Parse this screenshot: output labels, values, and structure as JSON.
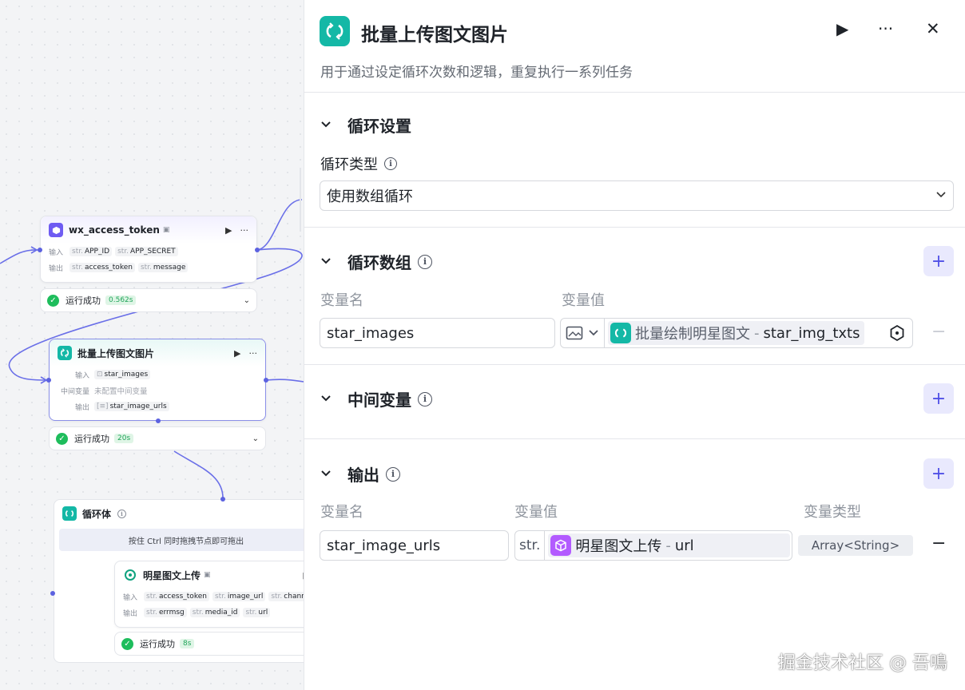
{
  "canvas": {
    "wx_node": {
      "title": "wx_access_token",
      "input_label": "输入",
      "output_label": "输出",
      "inputs": [
        {
          "type": "str.",
          "name": "APP_ID"
        },
        {
          "type": "str.",
          "name": "APP_SECRET"
        }
      ],
      "outputs": [
        {
          "type": "str.",
          "name": "access_token"
        },
        {
          "type": "str.",
          "name": "message"
        }
      ],
      "status": "运行成功",
      "time": "0.562s"
    },
    "loop_node": {
      "title": "批量上传图文图片",
      "input_label": "输入",
      "mid_label": "中间变量",
      "output_label": "输出",
      "input_value": "star_images",
      "mid_value": "未配置中间变量",
      "output_value": "star_image_urls",
      "status": "运行成功",
      "time": "20s"
    },
    "loop_body": {
      "title": "循环体",
      "hint": "按住 Ctrl 同时拖拽节点即可拖出"
    },
    "upload_node": {
      "title": "明星图文上传",
      "input_label": "输入",
      "output_label": "输出",
      "inputs": [
        {
          "type": "str.",
          "name": "access_token"
        },
        {
          "type": "str.",
          "name": "image_url"
        },
        {
          "type": "str.",
          "name": "channel"
        }
      ],
      "outputs": [
        {
          "type": "str.",
          "name": "errmsg"
        },
        {
          "type": "str.",
          "name": "media_id"
        },
        {
          "type": "str.",
          "name": "url"
        }
      ],
      "status": "运行成功",
      "time": "8s"
    }
  },
  "panel": {
    "title": "批量上传图文图片",
    "description": "用于通过设定循环次数和逻辑，重复执行一系列任务",
    "loop_settings": {
      "title": "循环设置",
      "type_label": "循环类型",
      "type_value": "使用数组循环"
    },
    "loop_array": {
      "title": "循环数组",
      "col_name": "变量名",
      "col_value": "变量值",
      "var_name": "star_images",
      "ref_node": "批量绘制明星图文",
      "ref_sep": "-",
      "ref_var": "star_img_txts"
    },
    "intermediate": {
      "title": "中间变量"
    },
    "output": {
      "title": "输出",
      "col_name": "变量名",
      "col_value": "变量值",
      "col_type": "变量类型",
      "var_name": "star_image_urls",
      "ref_type": "str.",
      "ref_node": "明星图文上传",
      "ref_sep": "-",
      "ref_var": "url",
      "var_type": "Array<String>"
    }
  },
  "watermark": "掘金技术社区 @ 吾鳴",
  "icons": {
    "play": "▶",
    "more": "···",
    "close": "✕",
    "chevron_down": "⌄",
    "info": "i",
    "add": "+",
    "minus": "−",
    "check": "✓"
  },
  "colors": {
    "accent": "#5050e6",
    "teal": "#14b8a6",
    "purple": "#6e5bf2",
    "success": "#1ebd5c"
  }
}
